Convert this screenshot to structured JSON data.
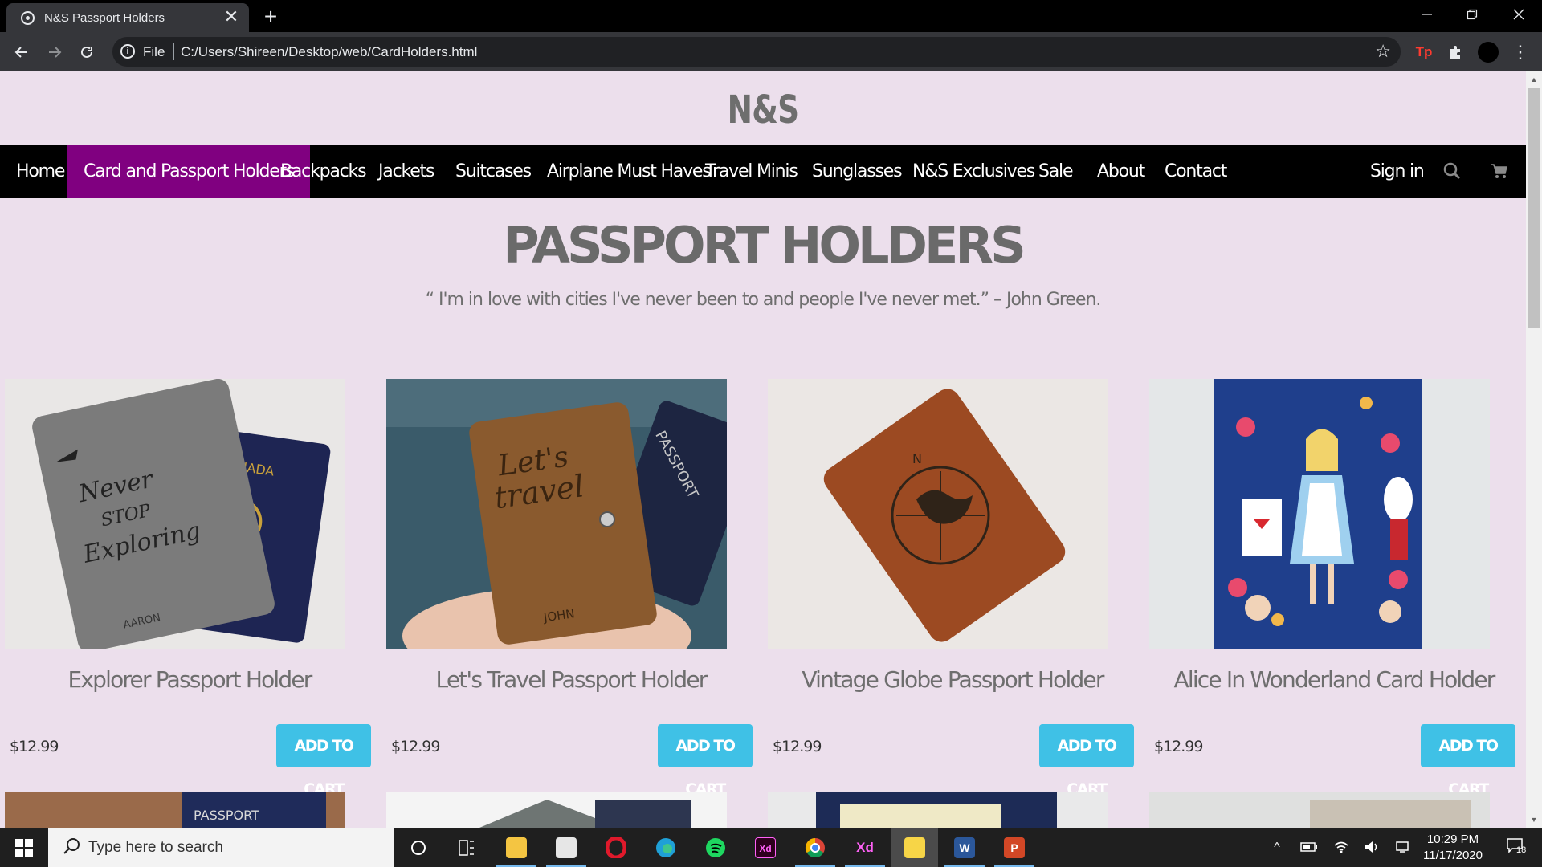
{
  "browser": {
    "tab_title": "N&S Passport Holders",
    "tab_close": "✕",
    "new_tab": "+",
    "scheme_label": "File",
    "url": "C:/Users/Shireen/Desktop/web/CardHolders.html",
    "extension_label": "Tp"
  },
  "site": {
    "brand": "N&S",
    "nav": [
      {
        "label": "Home"
      },
      {
        "label": "Card and Passport Holders",
        "active": true
      },
      {
        "label": "Backpacks"
      },
      {
        "label": "Jackets"
      },
      {
        "label": "Suitcases"
      },
      {
        "label": "Airplane Must Haves"
      },
      {
        "label": "Travel Minis"
      },
      {
        "label": "Sunglasses"
      },
      {
        "label": "N&S Exclusives"
      },
      {
        "label": "Sale"
      },
      {
        "label": "About"
      },
      {
        "label": "Contact"
      }
    ],
    "sign_in": "Sign in",
    "active_color": "#800080",
    "page_bg": "#ecdfec",
    "button_color": "#3fc1e6"
  },
  "main": {
    "title": "PASSPORT HOLDERS",
    "quote": "“ I'm in love with cities I've never been to and people I've never met.” – John Green.",
    "products": [
      {
        "name": "Explorer Passport Holder",
        "price": "$12.99",
        "button": "ADD TO CART",
        "image": "grey-passport-holder-never-stop-exploring"
      },
      {
        "name": "Let's Travel Passport Holder",
        "price": "$12.99",
        "button": "ADD TO CART",
        "image": "brown-leather-lets-travel-holder"
      },
      {
        "name": "Vintage Globe Passport Holder",
        "price": "$12.99",
        "button": "ADD TO CART",
        "image": "tan-leather-compass-globe-holder"
      },
      {
        "name": "Alice In Wonderland Card Holder",
        "price": "$12.99",
        "button": "ADD TO CART",
        "image": "alice-in-wonderland-floral-card-holder"
      }
    ]
  },
  "taskbar": {
    "search_placeholder": "Type here to search",
    "time": "10:29 PM",
    "date": "11/17/2020",
    "notification_count": "18",
    "xd_label": "Xd",
    "word_label": "W",
    "ppt_label": "P"
  }
}
